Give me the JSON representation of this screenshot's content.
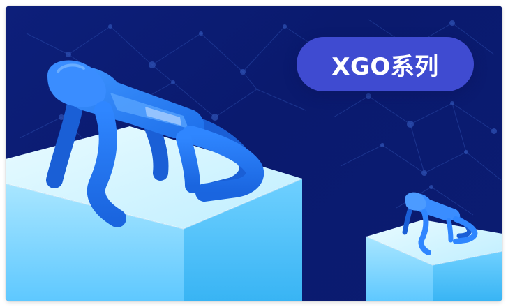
{
  "banner": {
    "badge_label": "XGO系列",
    "robot_large_icon": "robot-dog-icon",
    "robot_small_icon": "robot-dog-icon",
    "colors": {
      "background": "#0b1c72",
      "badge": "#3f4bd1",
      "cube_top": "#d8f6ff",
      "cube_left": "#8fd8ff",
      "cube_right": "#5cc2f7",
      "robot": "#1f78f2"
    }
  }
}
